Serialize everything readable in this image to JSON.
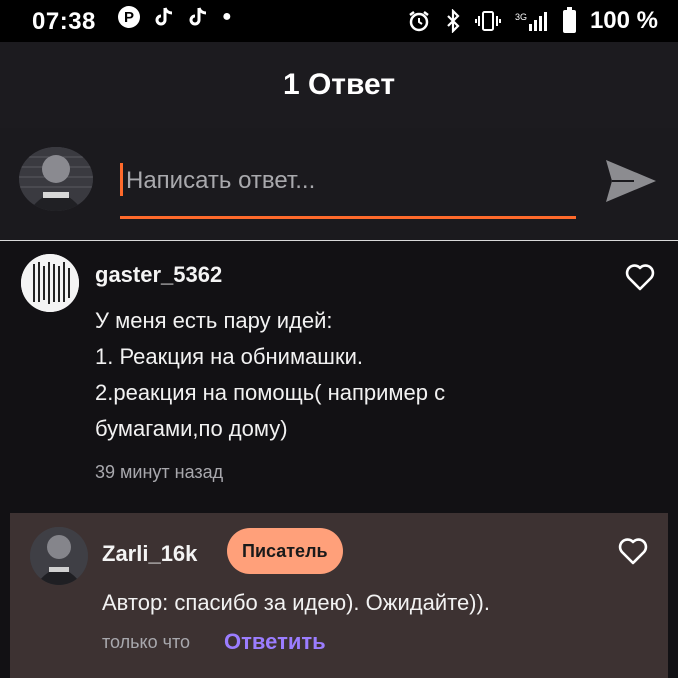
{
  "status_bar": {
    "time": "07:38",
    "left_icons": [
      "pinterest-icon",
      "tiktok-icon",
      "tiktok-icon",
      "dot-icon"
    ],
    "right_icons": [
      "alarm-icon",
      "bluetooth-icon",
      "vibrate-icon",
      "signal-icon",
      "battery-icon"
    ],
    "battery_text": "100 %"
  },
  "header": {
    "title": "1 Ответ"
  },
  "reply_bar": {
    "placeholder": "Написать ответ...",
    "accent_color": "#ff6a2b"
  },
  "comments": [
    {
      "username": "gaster_5362",
      "lines": [
        "У меня есть пару идей:",
        "1. Реакция на обнимашки.",
        "2.реакция на помощь( например с",
        "бумагами,по дому)"
      ],
      "time": "39 минут назад"
    },
    {
      "username": "Zarli_16k",
      "badge": "Писатель",
      "text": "Автор: спасибо за идею). Ожидайте)).",
      "time": "только что",
      "reply_label": "Ответить"
    }
  ],
  "colors": {
    "background": "#121114",
    "highlight_comment": "#3d3232",
    "badge": "#ffa07a",
    "reply_link": "#9b7dff"
  }
}
